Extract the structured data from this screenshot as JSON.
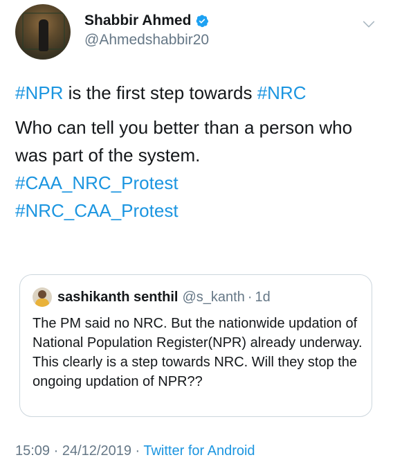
{
  "author": {
    "display_name": "Shabbir Ahmed",
    "handle": "@Ahmedshabbir20",
    "verified": true
  },
  "tweet": {
    "line1_hashtag1": "#NPR",
    "line1_text": " is the first step towards ",
    "line1_hashtag2": "#NRC",
    "paragraph2": "Who can tell you better than a person who was part of the system.",
    "hashtag3": "#CAA_NRC_Protest",
    "hashtag4": "#NRC_CAA_Protest"
  },
  "quoted_tweet": {
    "display_name": "sashikanth senthil",
    "handle": "@s_kanth",
    "separator": "·",
    "time": "1d",
    "text": "The PM said no NRC. But the nationwide updation of National Population Register(NPR) already underway. This clearly is a step towards NRC. Will they stop the ongoing updation of NPR??"
  },
  "meta": {
    "time": "15:09",
    "separator1": " · ",
    "date": "24/12/2019",
    "separator2": " · ",
    "source": "Twitter for Android"
  },
  "icons": {
    "verified": "verified-badge-icon",
    "menu": "chevron-down-icon"
  },
  "colors": {
    "link": "#1b95e0",
    "secondary_text": "#657786",
    "verified": "#1da1f2",
    "border": "#ccd6dd"
  }
}
